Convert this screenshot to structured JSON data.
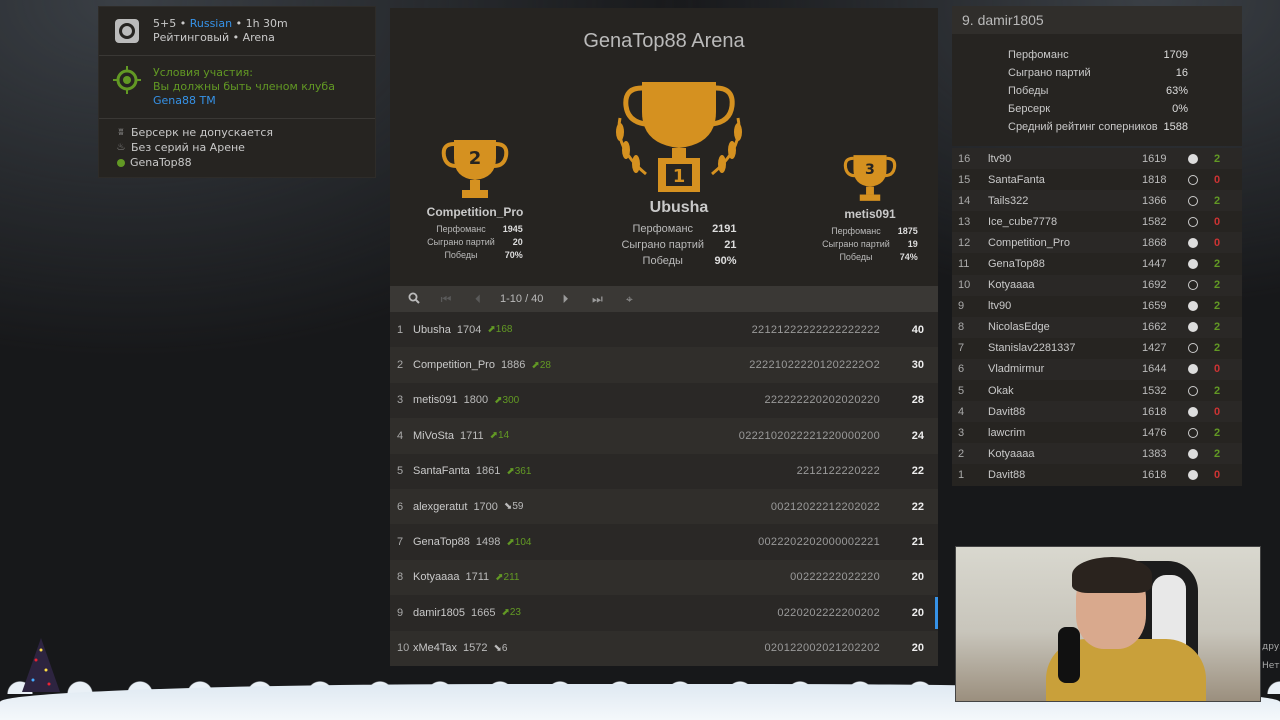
{
  "tournament": {
    "title": "GenaTop88 Arena",
    "format": "5+5",
    "separator": "•",
    "language": "Russian",
    "duration": "1h 30m",
    "type": "Рейтинговый • Arena",
    "conditions_title": "Условия участия:",
    "conditions_text": "Вы должны быть членом клуба",
    "club_link": "Gena88 TM",
    "berserk_rule": "Берсерк не допускается",
    "streak_rule": "Без серий на Арене",
    "creator": "GenaTop88"
  },
  "podium": [
    {
      "place": "2",
      "name": "Competition_Pro",
      "perf_label": "Перфоманс",
      "perf": "1945",
      "games_label": "Сыграно партий",
      "games": "20",
      "wins_label": "Победы",
      "wins": "70%"
    },
    {
      "place": "1",
      "name": "Ubusha",
      "perf_label": "Перфоманс",
      "perf": "2191",
      "games_label": "Сыграно партий",
      "games": "21",
      "wins_label": "Победы",
      "wins": "90%"
    },
    {
      "place": "3",
      "name": "metis091",
      "perf_label": "Перфоманс",
      "perf": "1875",
      "games_label": "Сыграно партий",
      "games": "19",
      "wins_label": "Победы",
      "wins": "74%"
    }
  ],
  "pager": {
    "range": "1-10 / 40"
  },
  "standings": [
    {
      "rank": "1",
      "name": "Ubusha",
      "rating": "1704",
      "diff": "168",
      "dir": "up",
      "sheet": "22121222222222222222",
      "score": "40"
    },
    {
      "rank": "2",
      "name": "Competition_Pro",
      "rating": "1886",
      "diff": "28",
      "dir": "up",
      "sheet": "222210222201202222O2",
      "score": "30"
    },
    {
      "rank": "3",
      "name": "metis091",
      "rating": "1800",
      "diff": "300",
      "dir": "up",
      "sheet": "222222220202020220",
      "score": "28"
    },
    {
      "rank": "4",
      "name": "MiVoSta",
      "rating": "1711",
      "diff": "14",
      "dir": "up",
      "sheet": "0222102022221220000200",
      "score": "24"
    },
    {
      "rank": "5",
      "name": "SantaFanta",
      "rating": "1861",
      "diff": "361",
      "dir": "up",
      "sheet": "2212122220222",
      "score": "22"
    },
    {
      "rank": "6",
      "name": "alexgeratut",
      "rating": "1700",
      "diff": "59",
      "dir": "down",
      "sheet": "00212022212202022",
      "score": "22"
    },
    {
      "rank": "7",
      "name": "GenaTop88",
      "rating": "1498",
      "diff": "104",
      "dir": "up",
      "sheet": "0022202202000002221",
      "score": "21"
    },
    {
      "rank": "8",
      "name": "Kotyaaaa",
      "rating": "1711",
      "diff": "211",
      "dir": "up",
      "sheet": "00222222022220",
      "score": "20"
    },
    {
      "rank": "9",
      "name": "damir1805",
      "rating": "1665",
      "diff": "23",
      "dir": "up",
      "sheet": "0220202222200202",
      "score": "20"
    },
    {
      "rank": "10",
      "name": "xMe4Tax",
      "rating": "1572",
      "diff": "6",
      "dir": "down",
      "sheet": "020122002021202202",
      "score": "20"
    }
  ],
  "player_panel": {
    "title": "9. damir1805",
    "stats": [
      {
        "label": "Перфоманс",
        "value": "1709"
      },
      {
        "label": "Сыграно партий",
        "value": "16"
      },
      {
        "label": "Победы",
        "value": "63%"
      },
      {
        "label": "Берсерк",
        "value": "0%"
      },
      {
        "label": "Средний рейтинг соперников",
        "value": "1588"
      }
    ]
  },
  "games": [
    {
      "n": "16",
      "opp": "ltv90",
      "rating": "1619",
      "color": "white",
      "res": "2",
      "kind": "win"
    },
    {
      "n": "15",
      "opp": "SantaFanta",
      "rating": "1818",
      "color": "black",
      "res": "0",
      "kind": "loss"
    },
    {
      "n": "14",
      "opp": "Tails322",
      "rating": "1366",
      "color": "black",
      "res": "2",
      "kind": "win"
    },
    {
      "n": "13",
      "opp": "Ice_cube7778",
      "rating": "1582",
      "color": "black",
      "res": "0",
      "kind": "loss"
    },
    {
      "n": "12",
      "opp": "Competition_Pro",
      "rating": "1868",
      "color": "white",
      "res": "0",
      "kind": "loss"
    },
    {
      "n": "11",
      "opp": "GenaTop88",
      "rating": "1447",
      "color": "white",
      "res": "2",
      "kind": "win"
    },
    {
      "n": "10",
      "opp": "Kotyaaaa",
      "rating": "1692",
      "color": "black",
      "res": "2",
      "kind": "win"
    },
    {
      "n": "9",
      "opp": "ltv90",
      "rating": "1659",
      "color": "white",
      "res": "2",
      "kind": "win"
    },
    {
      "n": "8",
      "opp": "NicolasEdge",
      "rating": "1662",
      "color": "white",
      "res": "2",
      "kind": "win"
    },
    {
      "n": "7",
      "opp": "Stanislav2281337",
      "rating": "1427",
      "color": "black",
      "res": "2",
      "kind": "win"
    },
    {
      "n": "6",
      "opp": "Vladmirmur",
      "rating": "1644",
      "color": "white",
      "res": "0",
      "kind": "loss"
    },
    {
      "n": "5",
      "opp": "Okak",
      "rating": "1532",
      "color": "black",
      "res": "2",
      "kind": "win"
    },
    {
      "n": "4",
      "opp": "Davit88",
      "rating": "1618",
      "color": "white",
      "res": "0",
      "kind": "loss"
    },
    {
      "n": "3",
      "opp": "lawcrim",
      "rating": "1476",
      "color": "black",
      "res": "2",
      "kind": "win"
    },
    {
      "n": "2",
      "opp": "Kotyaaaa",
      "rating": "1383",
      "color": "white",
      "res": "2",
      "kind": "win"
    },
    {
      "n": "1",
      "opp": "Davit88",
      "rating": "1618",
      "color": "white",
      "res": "0",
      "kind": "loss"
    }
  ],
  "side_text": [
    "друз",
    "Нет"
  ],
  "colors": {
    "accent": "#3692e7",
    "win": "#629924",
    "loss": "#cc3333",
    "gold": "#d59120"
  },
  "icons": [
    "arena-icon",
    "crosshair-icon",
    "rabbit-icon",
    "fire-icon",
    "trophy-icon",
    "search-icon",
    "first-page-icon",
    "prev-page-icon",
    "next-page-icon",
    "last-page-icon",
    "target-icon",
    "arrow-up-icon",
    "arrow-down-icon"
  ]
}
